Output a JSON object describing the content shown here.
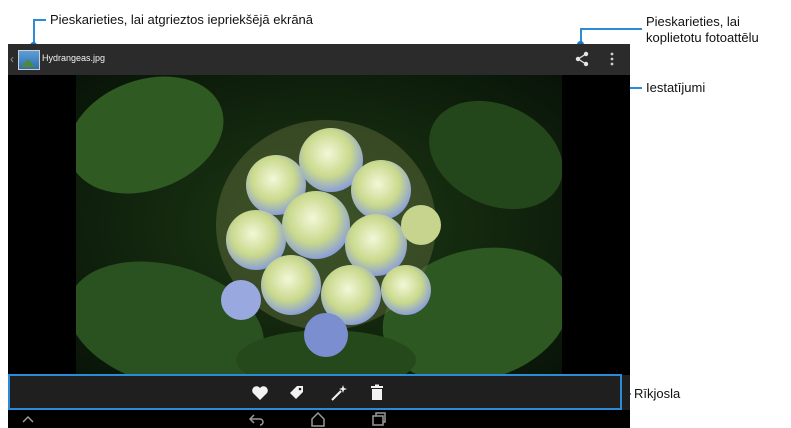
{
  "header": {
    "title": "Hydrangeas.jpg"
  },
  "annotations": {
    "back": "Pieskarieties, lai atgrieztos iepriekšējā ekrānā",
    "share_line1": "Pieskarieties, lai",
    "share_line2": "koplietotu fotoattēlu",
    "settings": "Iestatījumi",
    "toolbar": "Rīkjosla"
  },
  "icons": {
    "back": "chevron-left-icon",
    "app": "gallery-image-icon",
    "share": "share-icon",
    "menu": "overflow-menu-icon",
    "favorite": "heart-icon",
    "tag": "tag-icon",
    "edit": "magic-wand-icon",
    "delete": "trash-icon",
    "nav_back": "back-arrow-icon",
    "nav_home": "home-icon",
    "nav_recent": "recent-apps-icon",
    "nav_collapse": "chevron-up-icon"
  },
  "colors": {
    "annotation": "#2b8bd6",
    "topbar": "#2b2b2b",
    "toolbar": "#1f1f1f"
  }
}
